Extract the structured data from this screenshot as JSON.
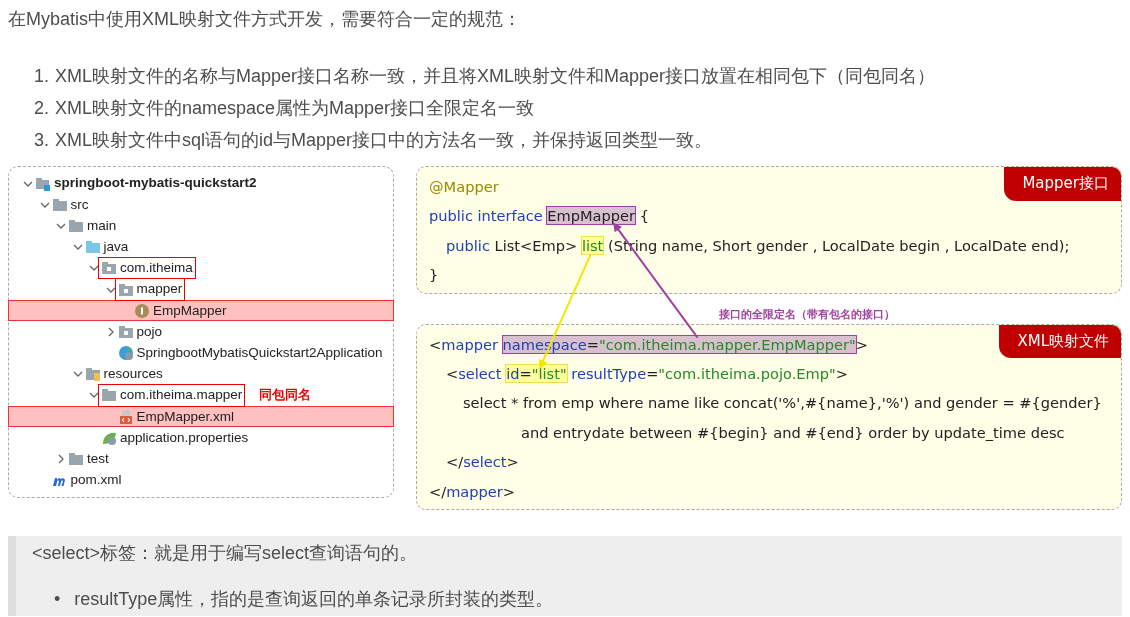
{
  "intro": "在Mybatis中使用XML映射文件方式开发，需要符合一定的规范：",
  "rules": [
    {
      "number": "1.",
      "text": "XML映射文件的名称与Mapper接口名称一致，并且将XML映射文件和Mapper接口放置在相同包下（同包同名）"
    },
    {
      "number": "2.",
      "text": "XML映射文件的namespace属性为Mapper接口全限定名一致"
    },
    {
      "number": "3.",
      "text": "XML映射文件中sql语句的id与Mapper接口中的方法名一致，并保持返回类型一致。"
    }
  ],
  "project_tree": [
    {
      "label": "springboot-mybatis-quickstart2",
      "kind": "module",
      "expanded": true,
      "highlighted": false,
      "boxed": false,
      "children": [
        {
          "label": "src",
          "kind": "folder",
          "expanded": true,
          "highlighted": false,
          "boxed": false,
          "children": [
            {
              "label": "main",
              "kind": "folder",
              "expanded": true,
              "highlighted": false,
              "boxed": false,
              "children": [
                {
                  "label": "java",
                  "kind": "source-folder",
                  "expanded": true,
                  "highlighted": false,
                  "boxed": false,
                  "children": [
                    {
                      "label": "com.itheima",
                      "kind": "package",
                      "expanded": true,
                      "highlighted": false,
                      "boxed": true,
                      "children": [
                        {
                          "label": "mapper",
                          "kind": "package",
                          "expanded": true,
                          "highlighted": false,
                          "boxed": true,
                          "children": [
                            {
                              "label": "EmpMapper",
                              "kind": "interface",
                              "highlighted": true,
                              "boxed": false
                            }
                          ]
                        },
                        {
                          "label": "pojo",
                          "kind": "package",
                          "expanded": false,
                          "highlighted": false,
                          "boxed": false
                        },
                        {
                          "label": "SpringbootMybatisQuickstart2Application",
                          "kind": "app-class",
                          "highlighted": false,
                          "boxed": false
                        }
                      ]
                    }
                  ]
                },
                {
                  "label": "resources",
                  "kind": "resource-folder",
                  "expanded": true,
                  "highlighted": false,
                  "boxed": false,
                  "children": [
                    {
                      "label": "com.itheima.mapper",
                      "kind": "folder",
                      "expanded": true,
                      "highlighted": false,
                      "boxed": true,
                      "note": "同包同名",
                      "children": [
                        {
                          "label": "EmpMapper.xml",
                          "kind": "xml",
                          "highlighted": true,
                          "boxed": false
                        }
                      ]
                    },
                    {
                      "label": "application.properties",
                      "kind": "properties",
                      "highlighted": false,
                      "boxed": false
                    }
                  ]
                }
              ]
            },
            {
              "label": "test",
              "kind": "folder",
              "expanded": false,
              "highlighted": false,
              "boxed": false
            }
          ]
        },
        {
          "label": "pom.xml",
          "kind": "maven",
          "highlighted": false,
          "boxed": false
        }
      ]
    }
  ],
  "code_panels": [
    {
      "tag": "Mapper接口",
      "lines": [
        {
          "tokens": [
            {
              "text": "@Mapper",
              "kind": "annotation"
            }
          ]
        },
        {
          "tokens": [
            {
              "text": "public interface ",
              "kind": "keyword"
            },
            {
              "kind": "marked-purple",
              "parts": [
                {
                  "text": "EmpMapper",
                  "kind": "plain"
                }
              ]
            },
            {
              "text": " {",
              "kind": "plain"
            }
          ],
          "children": [
            {
              "tokens": [
                {
                  "text": "public ",
                  "kind": "keyword"
                },
                {
                  "text": "List<Emp> ",
                  "kind": "plain"
                },
                {
                  "kind": "marked-yellow",
                  "parts": [
                    {
                      "text": "list",
                      "kind": "string"
                    }
                  ]
                },
                {
                  "text": " (String name, Short gender , LocalDate begin , LocalDate end);",
                  "kind": "plain"
                }
              ]
            }
          ]
        },
        {
          "tokens": [
            {
              "text": "}",
              "kind": "plain"
            }
          ]
        }
      ]
    },
    {
      "tag": "XML映射文件",
      "callout": "接口的全限定名（带有包名的接口）",
      "lines": [
        {
          "tokens": [
            {
              "text": "<",
              "kind": "plain"
            },
            {
              "text": "mapper ",
              "kind": "keyword"
            },
            {
              "kind": "marked-purple",
              "parts": [
                {
                  "text": "namespace",
                  "kind": "keyword"
                },
                {
                  "text": "=",
                  "kind": "plain"
                },
                {
                  "text": "\"com.itheima.mapper.EmpMapper\"",
                  "kind": "string"
                }
              ]
            },
            {
              "text": ">",
              "kind": "plain"
            }
          ],
          "children": [
            {
              "tokens": [
                {
                  "text": "<",
                  "kind": "plain"
                },
                {
                  "text": "select ",
                  "kind": "keyword"
                },
                {
                  "kind": "marked-yellow",
                  "parts": [
                    {
                      "text": "id",
                      "kind": "keyword"
                    },
                    {
                      "text": "=",
                      "kind": "plain"
                    },
                    {
                      "text": "\"list\"",
                      "kind": "string"
                    }
                  ]
                },
                {
                  "text": " resultType",
                  "kind": "keyword"
                },
                {
                  "text": "=",
                  "kind": "plain"
                },
                {
                  "text": "\"com.itheima.pojo.Emp\"",
                  "kind": "string"
                },
                {
                  "text": ">",
                  "kind": "plain"
                }
              ],
              "children": [
                {
                  "tokens": [
                    {
                      "text": "select * from emp where name like concat('%',#{name},'%') and gender = #{gender}",
                      "kind": "plain"
                    }
                  ],
                  "children": [
                    {
                      "tokens": [
                        {
                          "text": "and entrydate between #{begin} and #{end} order by update_time desc",
                          "kind": "plain"
                        }
                      ]
                    }
                  ]
                }
              ]
            },
            {
              "tokens": [
                {
                  "text": "</",
                  "kind": "plain"
                },
                {
                  "text": "select",
                  "kind": "keyword"
                },
                {
                  "text": ">",
                  "kind": "plain"
                }
              ]
            }
          ]
        },
        {
          "tokens": [
            {
              "text": "</",
              "kind": "plain"
            },
            {
              "text": "mapper",
              "kind": "keyword"
            },
            {
              "text": ">",
              "kind": "plain"
            }
          ]
        }
      ]
    }
  ],
  "quote": {
    "text": "<select>标签：就是用于编写select查询语句的。",
    "bullets": [
      {
        "marker": "•",
        "text": "resultType属性，指的是查询返回的单条记录所封装的类型。"
      }
    ]
  }
}
